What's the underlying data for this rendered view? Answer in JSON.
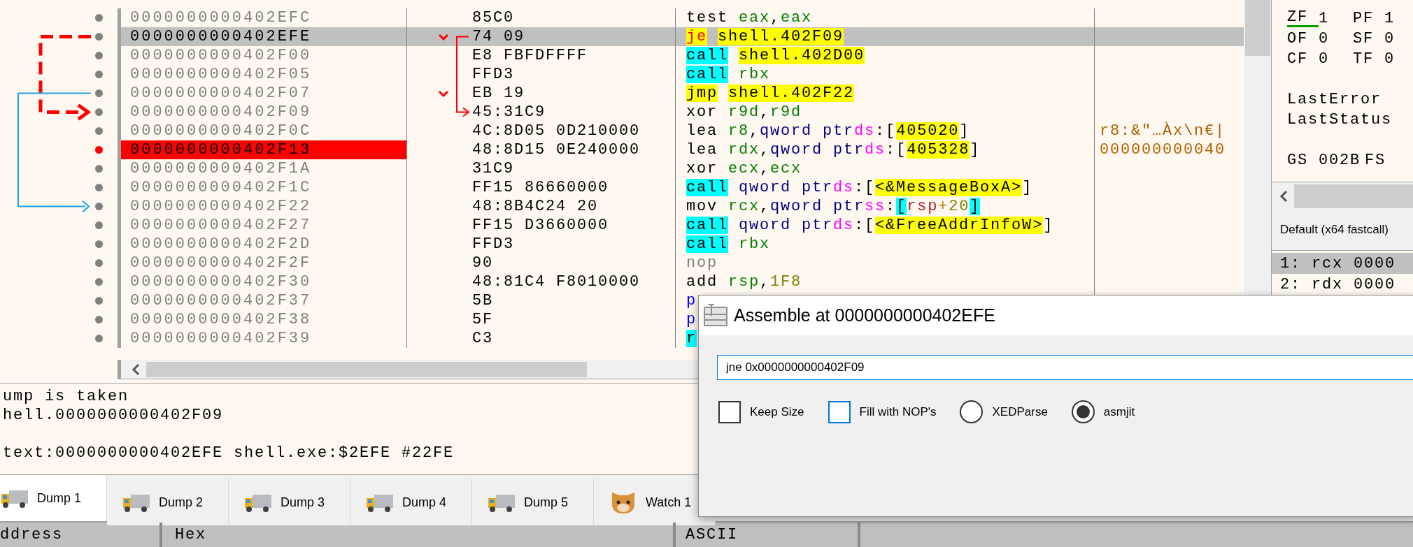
{
  "disassembly": {
    "rows": [
      {
        "address": "0000000000402EFC",
        "bytes": "85C0",
        "instruction": {
          "mnemonic": "test",
          "kind": "plain",
          "operands": [
            {
              "text": "eax",
              "kind": "register"
            },
            {
              "text": ",",
              "kind": "punct"
            },
            {
              "text": "eax",
              "kind": "register"
            }
          ]
        },
        "selected": false,
        "breakpoint": false,
        "jump_source": false,
        "jump_target": false
      },
      {
        "address": "0000000000402EFE",
        "bytes": "74 09",
        "instruction": {
          "mnemonic": "je",
          "kind": "cond_jump",
          "operands": [
            {
              "text": "shell.402F09",
              "kind": "address"
            }
          ]
        },
        "selected": true,
        "breakpoint": false,
        "jump_source": true,
        "jump_target": false
      },
      {
        "address": "0000000000402F00",
        "bytes": "E8 FBFDFFFF",
        "instruction": {
          "mnemonic": "call",
          "kind": "call",
          "operands": [
            {
              "text": "shell.402D00",
              "kind": "address"
            }
          ]
        },
        "selected": false,
        "breakpoint": false,
        "jump_source": false,
        "jump_target": false
      },
      {
        "address": "0000000000402F05",
        "bytes": "FFD3",
        "instruction": {
          "mnemonic": "call",
          "kind": "call",
          "operands": [
            {
              "text": "rbx",
              "kind": "register"
            }
          ]
        },
        "selected": false,
        "breakpoint": false,
        "jump_source": false,
        "jump_target": false
      },
      {
        "address": "0000000000402F07",
        "bytes": "EB 19",
        "instruction": {
          "mnemonic": "jmp",
          "kind": "jump",
          "operands": [
            {
              "text": "shell.402F22",
              "kind": "address"
            }
          ]
        },
        "selected": false,
        "breakpoint": false,
        "jump_source": true,
        "jump_target": false
      },
      {
        "address": "0000000000402F09",
        "bytes": "45:31C9",
        "instruction": {
          "mnemonic": "xor",
          "kind": "plain",
          "operands": [
            {
              "text": "r9d",
              "kind": "register"
            },
            {
              "text": ",",
              "kind": "punct"
            },
            {
              "text": "r9d",
              "kind": "register"
            }
          ]
        },
        "selected": false,
        "breakpoint": false,
        "jump_source": false,
        "jump_target": true
      },
      {
        "address": "0000000000402F0C",
        "bytes": "4C:8D05 0D210000",
        "instruction": {
          "mnemonic": "lea",
          "kind": "plain",
          "operands": [
            {
              "text": "r8",
              "kind": "register"
            },
            {
              "text": ",",
              "kind": "punct"
            },
            {
              "text": "qword ptr",
              "kind": "size"
            },
            {
              "text": "ds",
              "kind": "segment"
            },
            {
              "text": ":[",
              "kind": "punct"
            },
            {
              "text": "405020",
              "kind": "address"
            },
            {
              "text": "]",
              "kind": "punct"
            }
          ]
        },
        "comment": "r8:&\"…Àx\\n€|",
        "selected": false,
        "breakpoint": false,
        "jump_source": false,
        "jump_target": false
      },
      {
        "address": "0000000000402F13",
        "bytes": "48:8D15 0E240000",
        "instruction": {
          "mnemonic": "lea",
          "kind": "plain",
          "operands": [
            {
              "text": "rdx",
              "kind": "register"
            },
            {
              "text": ",",
              "kind": "punct"
            },
            {
              "text": "qword ptr",
              "kind": "size"
            },
            {
              "text": "ds",
              "kind": "segment"
            },
            {
              "text": ":[",
              "kind": "punct"
            },
            {
              "text": "405328",
              "kind": "address"
            },
            {
              "text": "]",
              "kind": "punct"
            }
          ]
        },
        "comment": "000000000040",
        "selected": false,
        "breakpoint": true,
        "jump_source": false,
        "jump_target": false
      },
      {
        "address": "0000000000402F1A",
        "bytes": "31C9",
        "instruction": {
          "mnemonic": "xor",
          "kind": "plain",
          "operands": [
            {
              "text": "ecx",
              "kind": "register"
            },
            {
              "text": ",",
              "kind": "punct"
            },
            {
              "text": "ecx",
              "kind": "register"
            }
          ]
        },
        "selected": false,
        "breakpoint": false,
        "jump_source": false,
        "jump_target": false
      },
      {
        "address": "0000000000402F1C",
        "bytes": "FF15 86660000",
        "instruction": {
          "mnemonic": "call",
          "kind": "call",
          "operands": [
            {
              "text": "qword ptr",
              "kind": "size"
            },
            {
              "text": "ds",
              "kind": "segment"
            },
            {
              "text": ":[",
              "kind": "punct"
            },
            {
              "text": "<&MessageBoxA>",
              "kind": "address"
            },
            {
              "text": "]",
              "kind": "punct"
            }
          ]
        },
        "selected": false,
        "breakpoint": false,
        "jump_source": false,
        "jump_target": false
      },
      {
        "address": "0000000000402F22",
        "bytes": "48:8B4C24 20",
        "instruction": {
          "mnemonic": "mov",
          "kind": "plain",
          "operands": [
            {
              "text": "rcx",
              "kind": "register"
            },
            {
              "text": ",",
              "kind": "punct"
            },
            {
              "text": "qword ptr",
              "kind": "size"
            },
            {
              "text": "ss",
              "kind": "segment"
            },
            {
              "text": ":",
              "kind": "punct"
            },
            {
              "text": "[",
              "kind": "bracket"
            },
            {
              "text": "rsp",
              "kind": "memreg"
            },
            {
              "text": "+",
              "kind": "operator"
            },
            {
              "text": "20",
              "kind": "number"
            },
            {
              "text": "]",
              "kind": "bracket"
            }
          ]
        },
        "selected": false,
        "breakpoint": false,
        "jump_source": false,
        "jump_target": true
      },
      {
        "address": "0000000000402F27",
        "bytes": "FF15 D3660000",
        "instruction": {
          "mnemonic": "call",
          "kind": "call",
          "operands": [
            {
              "text": "qword ptr",
              "kind": "size"
            },
            {
              "text": "ds",
              "kind": "segment"
            },
            {
              "text": ":[",
              "kind": "punct"
            },
            {
              "text": "<&FreeAddrInfoW>",
              "kind": "address"
            },
            {
              "text": "]",
              "kind": "punct"
            }
          ]
        },
        "selected": false,
        "breakpoint": false,
        "jump_source": false,
        "jump_target": false
      },
      {
        "address": "0000000000402F2D",
        "bytes": "FFD3",
        "instruction": {
          "mnemonic": "call",
          "kind": "call",
          "operands": [
            {
              "text": "rbx",
              "kind": "register"
            }
          ]
        },
        "selected": false,
        "breakpoint": false,
        "jump_source": false,
        "jump_target": false
      },
      {
        "address": "0000000000402F2F",
        "bytes": "90",
        "instruction": {
          "mnemonic": "nop",
          "kind": "nop"
        },
        "selected": false,
        "breakpoint": false,
        "jump_source": false,
        "jump_target": false
      },
      {
        "address": "0000000000402F30",
        "bytes": "48:81C4 F8010000",
        "instruction": {
          "mnemonic": "add",
          "kind": "plain",
          "operands": [
            {
              "text": "rsp",
              "kind": "register"
            },
            {
              "text": ",",
              "kind": "punct"
            },
            {
              "text": "1F8",
              "kind": "number"
            }
          ]
        },
        "selected": false,
        "breakpoint": false,
        "jump_source": false,
        "jump_target": false
      },
      {
        "address": "0000000000402F37",
        "bytes": "5B",
        "instruction": {
          "mnemonic": "p",
          "kind": "stack"
        },
        "selected": false,
        "breakpoint": false,
        "jump_source": false,
        "jump_target": false
      },
      {
        "address": "0000000000402F38",
        "bytes": "5F",
        "instruction": {
          "mnemonic": "p",
          "kind": "stack"
        },
        "selected": false,
        "breakpoint": false,
        "jump_source": false,
        "jump_target": false
      },
      {
        "address": "0000000000402F39",
        "bytes": "C3",
        "instruction": {
          "mnemonic": "r",
          "kind": "ret"
        },
        "selected": false,
        "breakpoint": false,
        "jump_source": false,
        "jump_target": false
      }
    ]
  },
  "registers": {
    "groups": [
      [
        {
          "cells": [
            {
              "name": "ZF",
              "value": "1",
              "jump_flag": true
            },
            {
              "name": "PF",
              "value": "1",
              "jump_flag": false
            }
          ]
        },
        {
          "cells": [
            {
              "name": "OF",
              "value": "0",
              "jump_flag": false
            },
            {
              "name": "SF",
              "value": "0",
              "jump_flag": false
            }
          ]
        },
        {
          "cells": [
            {
              "name": "CF",
              "value": "0",
              "jump_flag": false
            },
            {
              "name": "TF",
              "value": "0",
              "jump_flag": false
            }
          ]
        }
      ],
      [
        {
          "cells": [
            {
              "name": "LastError"
            }
          ]
        },
        {
          "cells": [
            {
              "name": "LastStatus"
            }
          ]
        }
      ],
      [
        {
          "cells": [
            {
              "name": "GS",
              "value": "002B"
            },
            {
              "name": "FS"
            }
          ]
        }
      ]
    ]
  },
  "call_args": {
    "convention": "Default (x64 fastcall)",
    "items": [
      {
        "text": "1: rcx 0000",
        "selected": true
      },
      {
        "text": "2: rdx 0000",
        "selected": false
      }
    ]
  },
  "info": {
    "paragraphs": [
      [
        "ump is taken",
        "hell.0000000000402F09"
      ],
      [
        "text:0000000000402EFE shell.exe:$2EFE #22FE"
      ]
    ]
  },
  "tabs": [
    {
      "label": "Dump 1",
      "kind": "dump",
      "selected": true
    },
    {
      "label": "Dump 2",
      "kind": "dump",
      "selected": false
    },
    {
      "label": "Dump 3",
      "kind": "dump",
      "selected": false
    },
    {
      "label": "Dump 4",
      "kind": "dump",
      "selected": false
    },
    {
      "label": "Dump 5",
      "kind": "dump",
      "selected": false
    },
    {
      "label": "Watch 1",
      "kind": "watch",
      "selected": false
    }
  ],
  "dump_header": {
    "columns": [
      "ddress",
      "Hex",
      "ASCII"
    ]
  },
  "dialog": {
    "title": "Assemble at 0000000000402EFE",
    "input": "jne 0x0000000000402F09",
    "options": [
      {
        "label": "Keep Size",
        "kind": "checkbox",
        "checked": false,
        "focused": false
      },
      {
        "label": "Fill with NOP's",
        "kind": "checkbox",
        "checked": false,
        "focused": true
      },
      {
        "label": "XEDParse",
        "kind": "radio",
        "selected": false
      },
      {
        "label": "asmjit",
        "kind": "radio",
        "selected": true
      }
    ]
  }
}
